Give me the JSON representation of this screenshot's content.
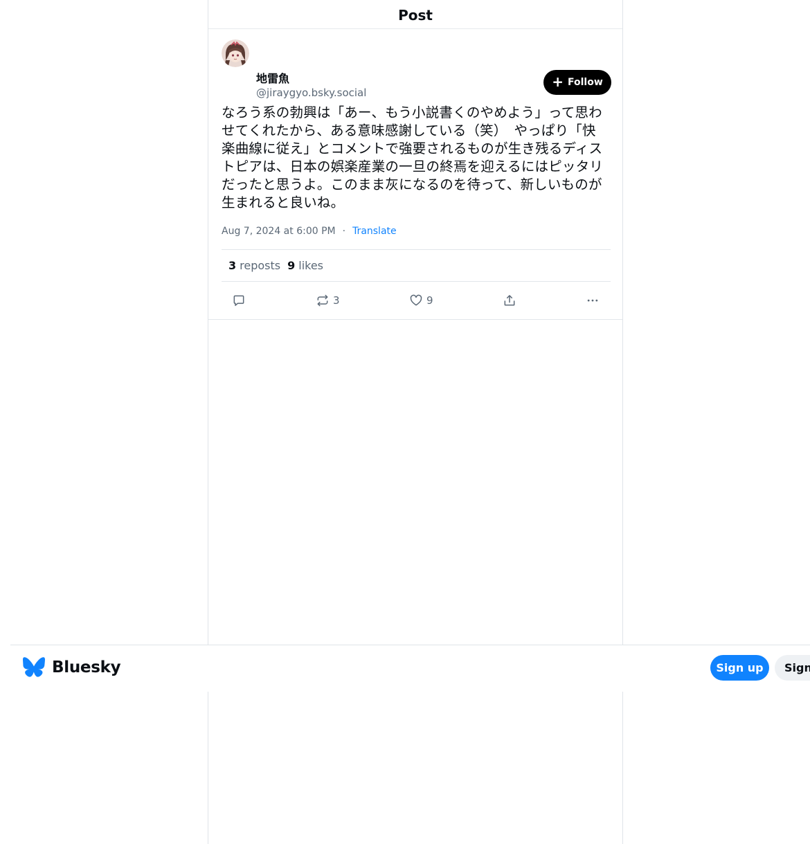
{
  "header": {
    "title": "Post"
  },
  "post": {
    "author": {
      "display_name": "地雷魚",
      "handle": "@jiraygyo.bsky.social",
      "avatar_icon": "avatar-anime-character"
    },
    "follow_label": "Follow",
    "text": "なろう系の勃興は「あー、もう小説書くのやめよう」って思わせてくれたから、ある意味感謝している（笑）　やっぱり「快楽曲線に従え」とコメントで強要されるものが生き残るディストピアは、日本の娯楽産業の一旦の終焉を迎えるにはピッタリだったと思うよ。このまま灰になるのを待って、新しいものが生まれると良いね。",
    "timestamp": "Aug 7, 2024 at 6:00 PM",
    "separator": "·",
    "translate_label": "Translate",
    "stats": {
      "reposts_count": "3",
      "reposts_label": "reposts",
      "likes_count": "9",
      "likes_label": "likes"
    },
    "actions": {
      "reply_icon": "reply-icon",
      "repost_icon": "repost-icon",
      "repost_count": "3",
      "like_icon": "heart-icon",
      "like_count": "9",
      "share_icon": "share-icon",
      "more_icon": "more-icon"
    }
  },
  "bottom_bar": {
    "brand_name": "Bluesky",
    "signup_label": "Sign up",
    "signin_label": "Sign"
  },
  "colors": {
    "accent": "#1083fe",
    "text_primary": "#0b0f14",
    "text_secondary": "#5b6876",
    "border": "#dfe3e8"
  }
}
